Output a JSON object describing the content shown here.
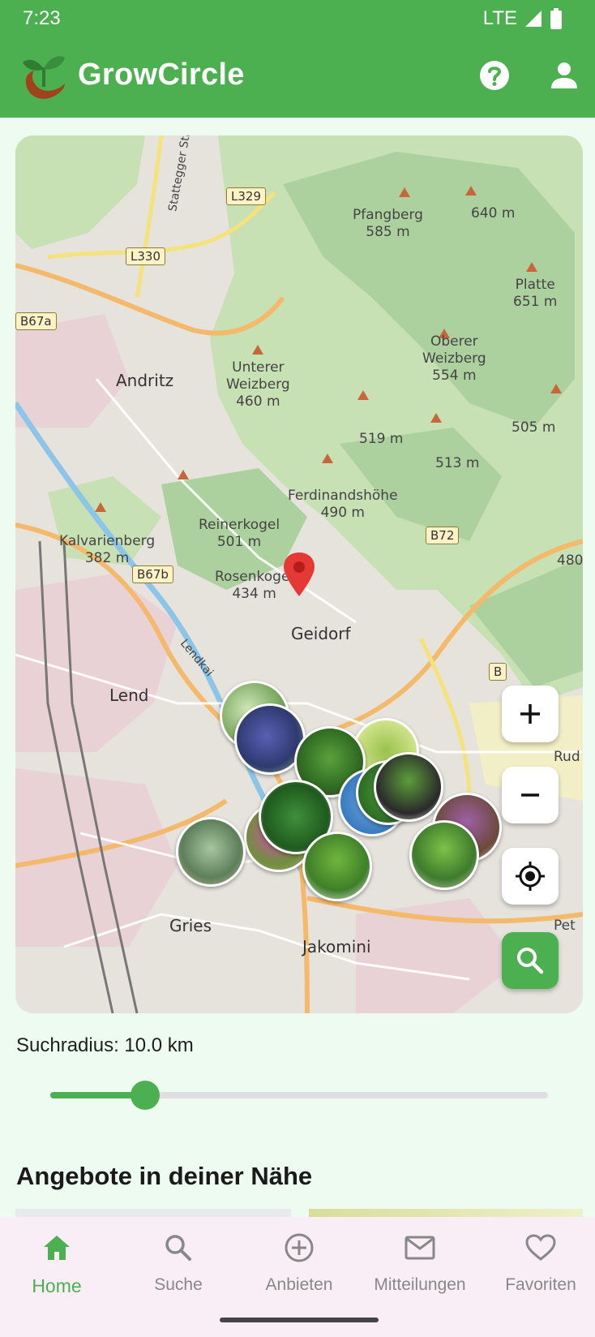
{
  "status_bar": {
    "time": "7:23",
    "network": "LTE"
  },
  "app_bar": {
    "title": "GrowCircle",
    "help_icon": "help-circle-icon",
    "account_icon": "account-icon"
  },
  "map": {
    "labels": {
      "pfangberg": "Pfangberg\n585 m",
      "peak640": "640 m",
      "platte": "Platte\n651 m",
      "andritz": "Andritz",
      "unterer": "Unterer\nWeizberg\n460 m",
      "oberer": "Oberer\nWeizberg\n554 m",
      "peak519": "519 m",
      "peak505": "505 m",
      "peak513": "513 m",
      "ferdinand": "Ferdinandshöhe\n490 m",
      "reinerkogel": "Reinerkogel\n501 m",
      "kalvarienberg": "Kalvarienberg\n382 m",
      "rosenkogel": "Rosenkogel\n434 m",
      "geidorf": "Geidorf",
      "lend": "Lend",
      "gries": "Gries",
      "jakomini": "Jakomini",
      "peak480": "480",
      "strasse": "Stattegger Stra",
      "lendkai": "Lendkai",
      "pet": "Pet",
      "rud": "Rud"
    },
    "roads": {
      "l329": "L329",
      "l330": "L330",
      "b67a": "B67a",
      "b67b": "B67b",
      "b72": "B72",
      "b_edge": "B"
    },
    "buttons": {
      "zoom_in": "+",
      "zoom_out": "−"
    }
  },
  "search_radius": {
    "label": "Suchradius: 10.0 km",
    "value_km": 10.0,
    "fraction": 0.19
  },
  "offers": {
    "title": "Angebote in deiner Nähe"
  },
  "bottom_nav": {
    "items": [
      {
        "label": "Home",
        "icon": "home-icon",
        "active": true
      },
      {
        "label": "Suche",
        "icon": "search-icon",
        "active": false
      },
      {
        "label": "Anbieten",
        "icon": "add-circle-icon",
        "active": false
      },
      {
        "label": "Mitteilungen",
        "icon": "mail-icon",
        "active": false
      },
      {
        "label": "Favoriten",
        "icon": "heart-icon",
        "active": false
      }
    ]
  },
  "colors": {
    "primary": "#4caf50",
    "background": "#eefbf1",
    "nav_background": "#f9edf6",
    "pin": "#e53935"
  }
}
